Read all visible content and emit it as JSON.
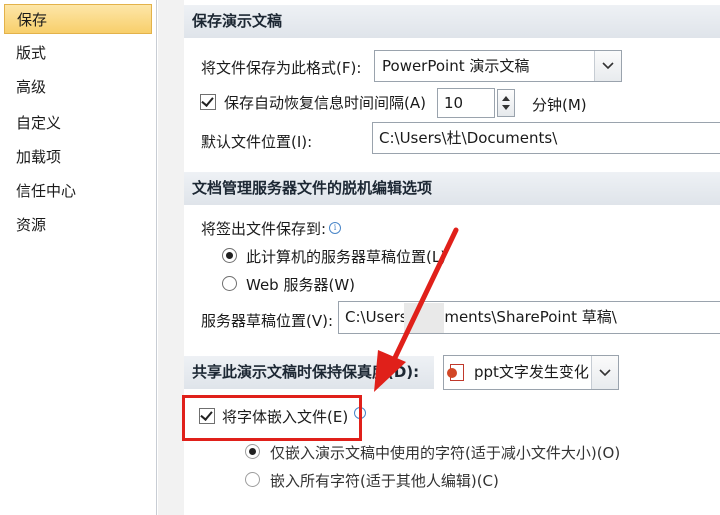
{
  "nav": {
    "items": [
      "保存",
      "版式",
      "高级",
      "自定义",
      "加载项",
      "信任中心",
      "资源"
    ]
  },
  "save_presentations": {
    "header": "保存演示文稿",
    "format_label": "将文件保存为此格式(F):",
    "format_value": "PowerPoint 演示文稿",
    "autorecover_label": "保存自动恢复信息时间间隔(A)",
    "autorecover_value": "10",
    "minutes_label": "分钟(M)",
    "default_location_label": "默认文件位置(I):",
    "default_location_value": "C:\\Users\\杜\\Documents\\"
  },
  "offline_editing": {
    "header": "文档管理服务器文件的脱机编辑选项",
    "save_checked_out_label": "将签出文件保存到:",
    "option_local": "此计算机的服务器草稿位置(L)",
    "option_web": "Web 服务器(W)",
    "drafts_location_label": "服务器草稿位置(V):",
    "drafts_location_value": "C:\\Users\\   ocuments\\SharePoint 草稿\\"
  },
  "fidelity": {
    "header": "共享此演示文稿时保持保真度(D):",
    "presentation_value": "ppt文字发生变化",
    "embed_fonts_label": "将字体嵌入文件(E)",
    "embed_only_used": "仅嵌入演示文稿中使用的字符(适于减小文件大小)(O)",
    "embed_all": "嵌入所有字符(适于其他人编辑)(C)"
  },
  "colors": {
    "highlight": "#e0201a",
    "nav_selected": "#f8cf6b",
    "section_header": "#dfe4ea"
  },
  "icons": {
    "check": "check-icon",
    "dropdown": "chevron-down-icon",
    "info": "info-icon",
    "ppt": "powerpoint-file-icon"
  }
}
